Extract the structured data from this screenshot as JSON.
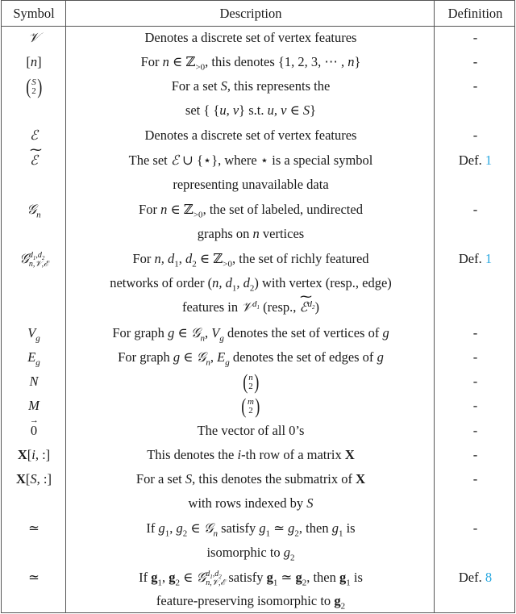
{
  "table": {
    "headers": {
      "symbol": "Symbol",
      "description": "Description",
      "definition": "Definition"
    },
    "rows": [
      {
        "symbol": "𝒱",
        "description": [
          "Denotes a discrete set of vertex features"
        ],
        "definition": "-"
      },
      {
        "symbol": "[n]",
        "description": [
          "For n ∈ ℤ>0, this denotes {1, 2, 3, ⋯ , n}"
        ],
        "definition": "-"
      },
      {
        "symbol": "(S choose 2)",
        "description": [
          "For a set S, this represents the",
          "set { {u, v} s.t. u, v ∈ S}"
        ],
        "definition": "-"
      },
      {
        "symbol": "ℰ",
        "description": [
          "Denotes a discrete set of vertex features"
        ],
        "definition": "-"
      },
      {
        "symbol": "ℰ̃",
        "description": [
          "The set ℰ ∪ {⋆}, where ⋆ is a special symbol",
          "representing unavailable data"
        ],
        "definition": "Def. 1"
      },
      {
        "symbol": "𝒢n",
        "description": [
          "For n ∈ ℤ>0, the set of labeled, undirected",
          "graphs on n vertices"
        ],
        "definition": "-"
      },
      {
        "symbol": "𝒢^{d1,d2}_{n,𝒱,ℰ}",
        "description": [
          "For n, d1, d2 ∈ ℤ>0, the set of richly featured",
          "networks of order (n, d1, d2) with vertex (resp., edge)",
          "features in 𝒱^d1 (resp., ℰ̃^d2)"
        ],
        "definition": "Def. 1"
      },
      {
        "symbol": "Vg",
        "description": [
          "For graph g ∈ 𝒢n, Vg denotes the set of vertices of g"
        ],
        "definition": "-"
      },
      {
        "symbol": "Eg",
        "description": [
          "For graph g ∈ 𝒢n, Eg denotes the set of edges of g"
        ],
        "definition": "-"
      },
      {
        "symbol": "N",
        "description": [
          "(n choose 2)"
        ],
        "definition": "-"
      },
      {
        "symbol": "M",
        "description": [
          "(m choose 2)"
        ],
        "definition": "-"
      },
      {
        "symbol": "0⃗",
        "description": [
          "The vector of all 0's"
        ],
        "definition": "-"
      },
      {
        "symbol": "X[i, :]",
        "description": [
          "This denotes the i-th row of a matrix X"
        ],
        "definition": "-"
      },
      {
        "symbol": "X[S, :]",
        "description": [
          "For a set S, this denotes the submatrix of X",
          "with rows indexed by S"
        ],
        "definition": "-"
      },
      {
        "symbol": "≃",
        "description": [
          "If g1, g2 ∈ 𝒢n satisfy g1 ≃ g2, then g1 is",
          "isomorphic to g2"
        ],
        "definition": "-"
      },
      {
        "symbol": "≃",
        "description": [
          "If g1, g2 ∈ 𝒢^{d1,d2}_{n,𝒱,ℰ} satisfy g1 ≃ g2, then g1 is",
          "feature-preserving isomorphic to g2"
        ],
        "definition": "Def. 8"
      }
    ],
    "def_prefix": "Def.",
    "def_refs": {
      "r5": "1",
      "r7": "1",
      "r16": "8"
    },
    "link_color": "#29a8e0",
    "dash": "-"
  }
}
